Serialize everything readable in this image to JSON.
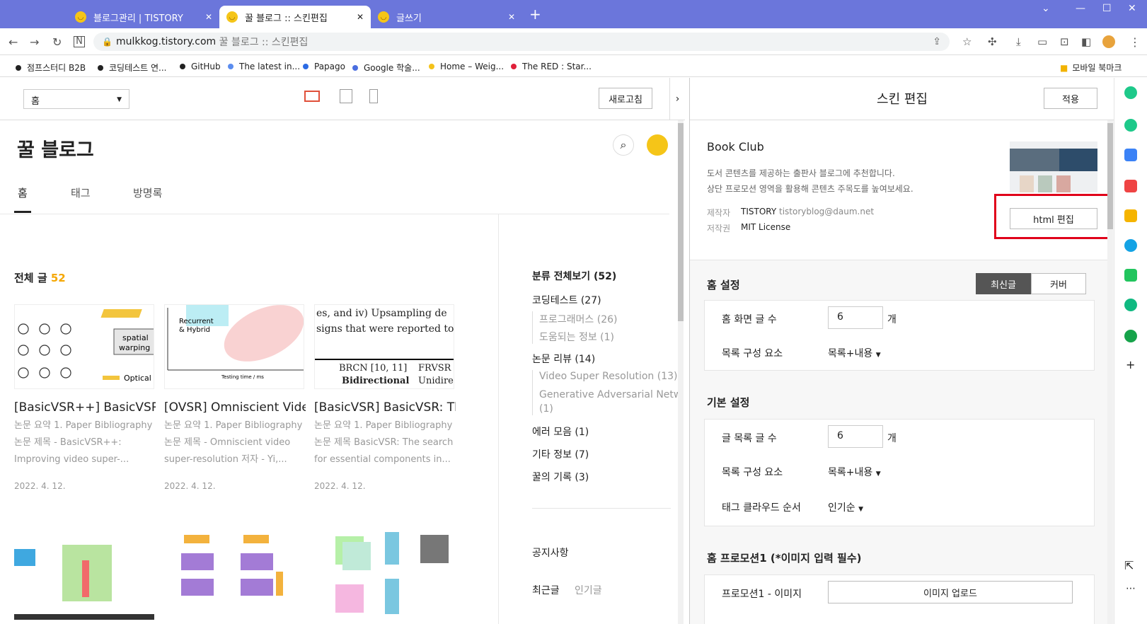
{
  "tabs": [
    {
      "label": "블로그관리 | TISTORY"
    },
    {
      "label": "꿀 블로그 :: 스킨편집"
    },
    {
      "label": "글쓰기"
    }
  ],
  "url": {
    "domain": "mulkkog.tistory.com",
    "title": "꿀 블로그 :: 스킨편집"
  },
  "bookmarks": [
    {
      "label": "점프스터디 B2B",
      "color": "#222"
    },
    {
      "label": "코딩테스트 연...",
      "color": "#222"
    },
    {
      "label": "GitHub",
      "color": "#222"
    },
    {
      "label": "The latest in...",
      "color": "#5b8def"
    },
    {
      "label": "Papago",
      "color": "#2b6be4"
    },
    {
      "label": "Google 학술...",
      "color": "#4a6ee0"
    },
    {
      "label": "Home – Weig...",
      "color": "#f4c21a"
    },
    {
      "label": "The RED : Star...",
      "color": "#e0203a"
    }
  ],
  "mobile_bookmark": "모바일 북마크",
  "toolbar": {
    "select": "홈",
    "refresh": "새로고침"
  },
  "blog": {
    "title": "꿀 블로그",
    "nav": [
      "홈",
      "태그",
      "방명록"
    ],
    "all_posts": "전체 글",
    "count": "52"
  },
  "posts": [
    {
      "title": "[BasicVSR++] BasicVSR+...",
      "ex1": "논문 요약 1. Paper Bibliography",
      "ex2": "논문 제목 - BasicVSR++:",
      "ex3": "Improving video super-...",
      "date": "2022. 4. 12."
    },
    {
      "title": "[OVSR] Omniscient Vide...",
      "ex1": "논문 요약 1. Paper Bibliography",
      "ex2": "논문 제목 - Omniscient video",
      "ex3": "super-resolution 저자 - Yi,...",
      "date": "2022. 4. 12."
    },
    {
      "title": "[BasicVSR] BasicVSR: Th...",
      "ex1": "논문 요약 1. Paper Bibliography",
      "ex2": "논문 제목 BasicVSR: The search",
      "ex3": "for essential components in...",
      "date": "2022. 4. 12."
    }
  ],
  "thumbs": {
    "t1a": "spatial",
    "t1b": "warping",
    "t1c": "Optical",
    "t2a": "Recurrent",
    "t2b": "& Hybrid",
    "t2c": "Testing time / ms",
    "t3a": "es, and iv) Upsampling de",
    "t3b": "signs that were reported to",
    "t3c": "BRCN [10, 11]",
    "t3d": "FRVSR",
    "t3e": "Bidirectional",
    "t3f": "Unidirec"
  },
  "categories": {
    "all": "분류 전체보기 (52)",
    "items": [
      "코딩테스트 (27)",
      "프로그래머스 (26)",
      "도움되는 정보 (1)",
      "논문 리뷰 (14)",
      "Video Super Resolution (13)",
      "Generative Adversarial Netw..",
      "(1)",
      "에러 모음 (1)",
      "기타 정보 (7)",
      "꿀의 기록 (3)"
    ],
    "notice": "공지사항",
    "recent": "최근글",
    "popular": "인기글"
  },
  "skin": {
    "header": "스킨 편집",
    "apply": "적용",
    "name": "Book Club",
    "desc1": "도서 콘텐츠를 제공하는 출판사 블로그에 추천합니다.",
    "desc2": "상단 프로모션 영역을 활용해 콘텐츠 주목도를 높여보세요.",
    "maker_label": "제작자",
    "maker": "TISTORY",
    "email": "tistoryblog@daum.net",
    "license_label": "저작권",
    "license": "MIT License",
    "html_edit": "html 편집"
  },
  "home": {
    "title": "홈 설정",
    "tab1": "최신글",
    "tab2": "커버",
    "r1": "홈 화면 글 수",
    "v1": "6",
    "unit": "개",
    "r2": "목록 구성 요소",
    "v2": "목록+내용"
  },
  "basic": {
    "title": "기본 설정",
    "r1": "글 목록 글 수",
    "v1": "6",
    "unit": "개",
    "r2": "목록 구성 요소",
    "v2": "목록+내용",
    "r3": "태그 클라우드 순서",
    "v3": "인기순"
  },
  "promo": {
    "title": "홈 프로모션1 (*이미지 입력 필수)",
    "r1": "프로모션1 - 이미지",
    "btn": "이미지 업로드"
  },
  "colors": {
    "accent": "#f5a700",
    "highlight": "#e0001a",
    "tabbar": "#6b76db"
  }
}
